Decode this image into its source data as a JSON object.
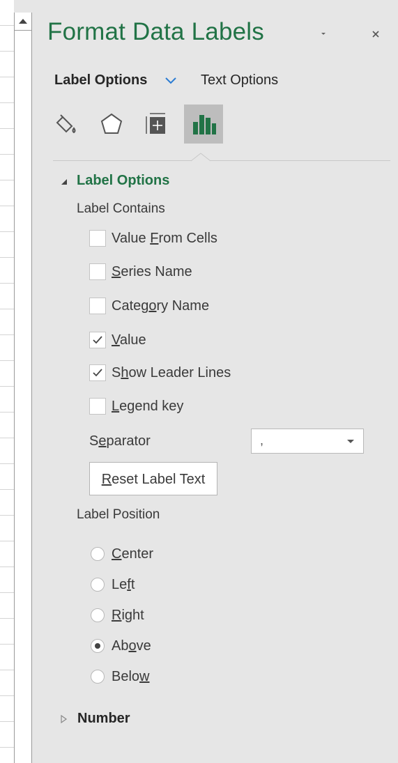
{
  "pane": {
    "title": "Format Data Labels",
    "menu_icon": "chevron-down-small-icon",
    "close_icon": "close-icon"
  },
  "tabs": {
    "active": "Label Options",
    "other": "Text Options"
  },
  "icon_toolbar": [
    {
      "name": "fill-line-icon",
      "selected": false
    },
    {
      "name": "effects-pentagon-icon",
      "selected": false
    },
    {
      "name": "size-properties-icon",
      "selected": false
    },
    {
      "name": "label-options-chart-icon",
      "selected": true
    }
  ],
  "label_options": {
    "heading": "Label Options",
    "contains_heading": "Label Contains",
    "checkboxes": [
      {
        "before": "Value ",
        "key": "F",
        "after": "rom Cells",
        "checked": false
      },
      {
        "before": "",
        "key": "S",
        "after": "eries Name",
        "checked": false
      },
      {
        "before": "Categ",
        "key": "o",
        "after": "ry Name",
        "checked": false
      },
      {
        "before": "",
        "key": "V",
        "after": "alue",
        "checked": true
      },
      {
        "before": "S",
        "key": "h",
        "after": "ow Leader Lines",
        "checked": true
      },
      {
        "before": "",
        "key": "L",
        "after": "egend key",
        "checked": false
      }
    ],
    "separator": {
      "before": "S",
      "key": "e",
      "after": "parator",
      "value": ","
    },
    "reset_button": {
      "before": "",
      "key": "R",
      "after": "eset Label Text"
    },
    "position_heading": "Label Position",
    "positions": [
      {
        "before": "",
        "key": "C",
        "after": "enter",
        "selected": false
      },
      {
        "before": "Le",
        "key": "f",
        "after": "t",
        "selected": false
      },
      {
        "before": "",
        "key": "R",
        "after": "ight",
        "selected": false
      },
      {
        "before": "Ab",
        "key": "o",
        "after": "ve",
        "selected": true
      },
      {
        "before": "Belo",
        "key": "w",
        "after": "",
        "selected": false
      }
    ]
  },
  "number_section": {
    "heading": "Number"
  },
  "colors": {
    "accent": "#217346",
    "pane_bg": "#e6e6e6",
    "selected_icon_bg": "#bdbdbd"
  }
}
